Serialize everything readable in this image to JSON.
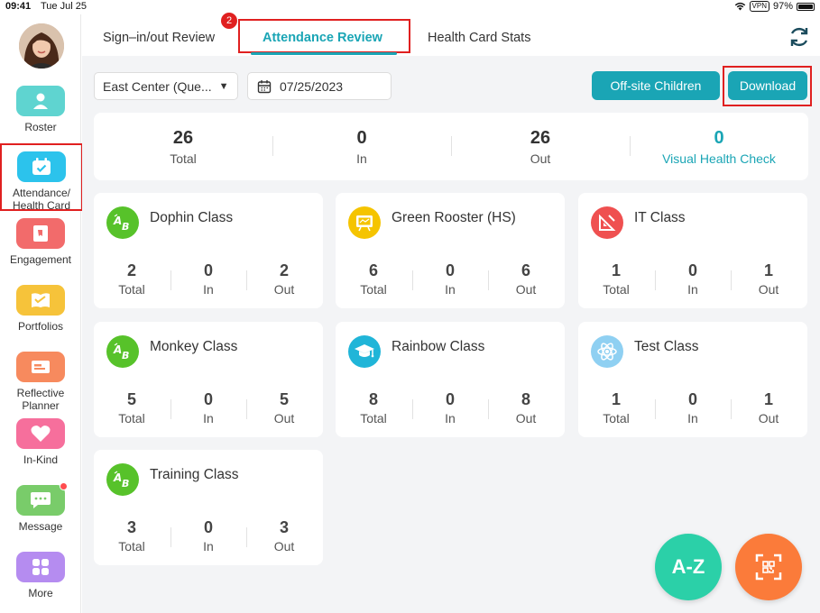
{
  "status_bar": {
    "time": "09:41",
    "date": "Tue Jul 25",
    "vpn": "VPN",
    "battery": "97%",
    "battery_level": 0.97
  },
  "sidebar": {
    "items": [
      {
        "label": "Roster",
        "icon": "roster-icon",
        "color": "#5fd4d0"
      },
      {
        "label": "Attendance/\nHealth Card",
        "icon": "calendar-check-icon",
        "color": "#2cc3ec"
      },
      {
        "label": "Engagement",
        "icon": "engagement-icon",
        "color": "#f26b6b"
      },
      {
        "label": "Portfolios",
        "icon": "portfolio-icon",
        "color": "#f6c33a"
      },
      {
        "label": "Reflective\nPlanner",
        "icon": "planner-icon",
        "color": "#f78a5e"
      },
      {
        "label": "In-Kind",
        "icon": "heart-icon",
        "color": "#f66f9c"
      },
      {
        "label": "Message",
        "icon": "message-icon",
        "color": "#79cc6a"
      },
      {
        "label": "More",
        "icon": "grid-icon",
        "color": "#b58cf0"
      }
    ]
  },
  "tabs": {
    "items": [
      "Sign–in/out Review",
      "Attendance Review",
      "Health Card Stats"
    ],
    "active_index": 1,
    "badge": "2"
  },
  "toolbar": {
    "center_select": "East Center (Que...",
    "date": "07/25/2023",
    "offsite_button": "Off-site Children",
    "download_button": "Download"
  },
  "summary": [
    {
      "value": "26",
      "label": "Total"
    },
    {
      "value": "0",
      "label": "In"
    },
    {
      "value": "26",
      "label": "Out"
    },
    {
      "value": "0",
      "label": "Visual Health Check"
    }
  ],
  "classes": [
    {
      "name": "Dophin Class",
      "icon": "ab-letters-icon",
      "color": "#57c22a",
      "total": "2",
      "in": "0",
      "out": "2"
    },
    {
      "name": "Green Rooster (HS)",
      "icon": "chalkboard-icon",
      "color": "#f5c400",
      "total": "6",
      "in": "0",
      "out": "6"
    },
    {
      "name": "IT Class",
      "icon": "ruler-triangle-icon",
      "color": "#ef5050",
      "total": "1",
      "in": "0",
      "out": "1"
    },
    {
      "name": "Monkey Class",
      "icon": "ab-letters-icon",
      "color": "#57c22a",
      "total": "5",
      "in": "0",
      "out": "5"
    },
    {
      "name": "Rainbow Class",
      "icon": "graduation-cap-icon",
      "color": "#20b5d8",
      "total": "8",
      "in": "0",
      "out": "8"
    },
    {
      "name": "Test Class",
      "icon": "atom-icon",
      "color": "#8fd0f2",
      "total": "1",
      "in": "0",
      "out": "1"
    },
    {
      "name": "Training Class",
      "icon": "ab-letters-icon",
      "color": "#57c22a",
      "total": "3",
      "in": "0",
      "out": "3"
    }
  ],
  "stat_labels": {
    "total": "Total",
    "in": "In",
    "out": "Out"
  },
  "fab": {
    "az_label": "A-Z",
    "az_color": "#2bd0a8",
    "scan_icon": "qr-scan-icon",
    "scan_color": "#fb7b3a"
  },
  "accent": "#1aa5b5"
}
